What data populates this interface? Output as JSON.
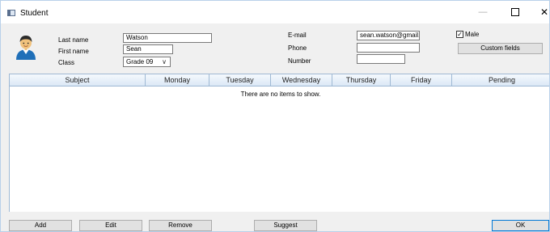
{
  "window": {
    "title": "Student",
    "controls": {
      "minimize": "—",
      "maximize": "",
      "close": "✕"
    }
  },
  "student": {
    "last_name_label": "Last name",
    "last_name_value": "Watson",
    "first_name_label": "First name",
    "first_name_value": "Sean",
    "class_label": "Class",
    "class_value": "Grade 09",
    "email_label": "E-mail",
    "email_value": "sean.watson@gmail.c",
    "phone_label": "Phone",
    "phone_value": "",
    "number_label": "Number",
    "number_value": "",
    "male_label": "Male",
    "male_checked": true,
    "custom_fields_label": "Custom fields"
  },
  "grid": {
    "columns": [
      "Subject",
      "Monday",
      "Tuesday",
      "Wednesday",
      "Thursday",
      "Friday",
      "Pending"
    ],
    "empty_message": "There are no items to show."
  },
  "footer": {
    "add_label": "Add",
    "edit_label": "Edit",
    "remove_label": "Remove",
    "suggest_label": "Suggest",
    "ok_label": "OK"
  },
  "colors": {
    "grid_header_border": "#9fb9d4",
    "primary_button_border": "#0078d7"
  }
}
